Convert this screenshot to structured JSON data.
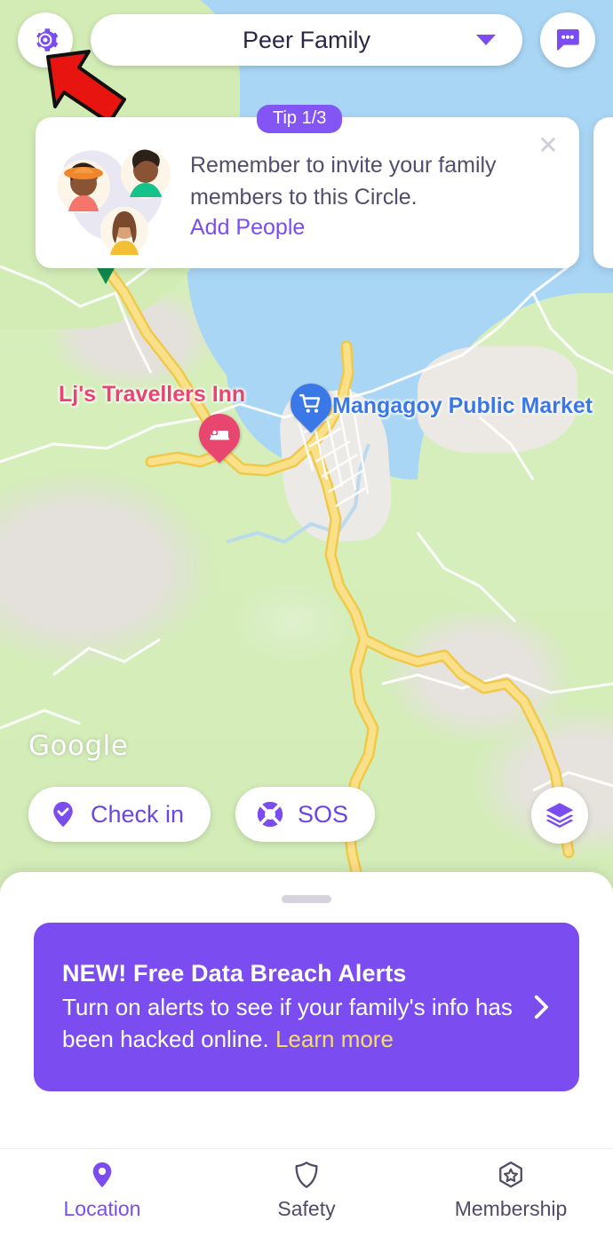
{
  "colors": {
    "brand_purple": "#7b4df0",
    "badge_purple": "#8355f5",
    "promo_link_yellow": "#f5dd6a",
    "pin_pink": "#e8456f",
    "pin_blue": "#3b78e7",
    "map_land_green": "#d3ecb5",
    "map_water_blue": "#a9d6f5",
    "road_yellow": "#fbd96b",
    "annotation_red": "#e8140f"
  },
  "topbar": {
    "settings_icon": "gear-icon",
    "circle_name": "Peer Family",
    "circle_caret_icon": "chevron-down-icon",
    "messages_icon": "chat-bubble-icon"
  },
  "annotation": {
    "type": "arrow",
    "points_to": "settings-gear-button"
  },
  "tip_card": {
    "badge": "Tip 1/3",
    "message": "Remember to invite your family members to this Circle.",
    "cta": "Add People",
    "close_icon": "close-icon",
    "avatars": [
      {
        "name": "avatar-woman-orange-hat",
        "hat": "#f0862c",
        "hair": "#2e2119",
        "shirt": "#f5746b",
        "skin": "#8a5434"
      },
      {
        "name": "avatar-person-green-shirt",
        "hat": "",
        "hair": "#2c2119",
        "shirt": "#14c28a",
        "skin": "#8a5434"
      },
      {
        "name": "avatar-woman-yellow-top",
        "hat": "",
        "hair": "#7a4a2c",
        "shirt": "#f3bf34",
        "skin": "#d9a278"
      }
    ]
  },
  "map": {
    "labels": [
      {
        "name": "Lj's Travellers Inn",
        "color": "#e8456f"
      },
      {
        "name": "Mangagoy Public Market",
        "color": "#3b78e7"
      }
    ],
    "pins": [
      {
        "name": "lodging-pin",
        "icon": "bed-icon",
        "color": "#e8456f"
      },
      {
        "name": "market-pin",
        "icon": "shopping-cart-icon",
        "color": "#3b78e7"
      }
    ],
    "attribution": "Google",
    "actions": [
      {
        "label": "Check in",
        "icon": "pin-check-icon"
      },
      {
        "label": "SOS",
        "icon": "lifebuoy-icon"
      }
    ],
    "layers_icon": "layers-icon"
  },
  "promo": {
    "title": "NEW! Free Data Breach Alerts",
    "body": "Turn on alerts to see if your family's info has been hacked online. ",
    "link": "Learn more",
    "chevron_icon": "chevron-right-icon"
  },
  "bottom_nav": {
    "items": [
      {
        "label": "Location",
        "icon": "location-pin-icon",
        "active": true
      },
      {
        "label": "Safety",
        "icon": "shield-icon",
        "active": false
      },
      {
        "label": "Membership",
        "icon": "star-hexagon-icon",
        "active": false
      }
    ]
  }
}
